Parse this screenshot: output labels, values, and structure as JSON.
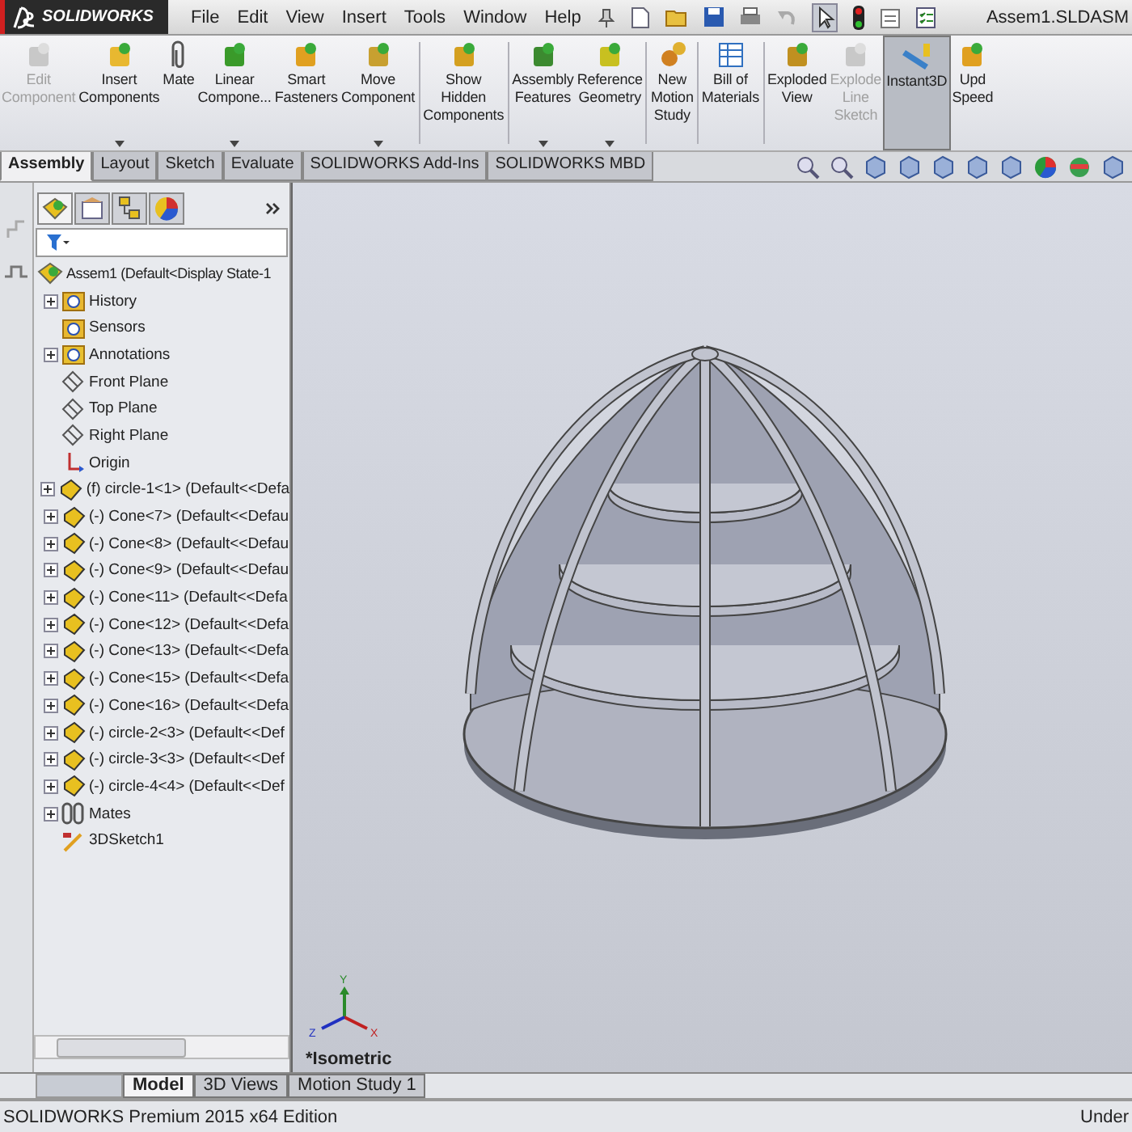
{
  "app_bar": {
    "logo": "SOLIDWORKS",
    "menu": [
      "File",
      "Edit",
      "View",
      "Insert",
      "Tools",
      "Window",
      "Help"
    ],
    "document_title": "Assem1.SLDASM"
  },
  "ribbon": [
    {
      "items": [
        {
          "label": "Edit\nComponent",
          "disabled": true,
          "dropdown": false,
          "selected": false
        },
        {
          "label": "Insert\nComponents",
          "disabled": false,
          "dropdown": true,
          "selected": false
        },
        {
          "label": "Mate",
          "disabled": false,
          "dropdown": false,
          "selected": false
        },
        {
          "label": "Linear\nCompone...",
          "disabled": false,
          "dropdown": true,
          "selected": false
        },
        {
          "label": "Smart\nFasteners",
          "disabled": false,
          "dropdown": false,
          "selected": false
        },
        {
          "label": "Move\nComponent",
          "disabled": false,
          "dropdown": true,
          "selected": false
        }
      ]
    },
    {
      "items": [
        {
          "label": "Show\nHidden\nComponents",
          "disabled": false,
          "dropdown": false,
          "selected": false
        }
      ]
    },
    {
      "items": [
        {
          "label": "Assembly\nFeatures",
          "disabled": false,
          "dropdown": true,
          "selected": false
        },
        {
          "label": "Reference\nGeometry",
          "disabled": false,
          "dropdown": true,
          "selected": false
        }
      ]
    },
    {
      "items": [
        {
          "label": "New\nMotion\nStudy",
          "disabled": false,
          "dropdown": false,
          "selected": false
        }
      ]
    },
    {
      "items": [
        {
          "label": "Bill of\nMaterials",
          "disabled": false,
          "dropdown": false,
          "selected": false
        }
      ]
    },
    {
      "items": [
        {
          "label": "Exploded\nView",
          "disabled": false,
          "dropdown": false,
          "selected": false
        },
        {
          "label": "Explode\nLine\nSketch",
          "disabled": true,
          "dropdown": false,
          "selected": false
        },
        {
          "label": "Instant3D",
          "disabled": false,
          "dropdown": false,
          "selected": true
        },
        {
          "label": "Upd\nSpeed",
          "disabled": false,
          "dropdown": false,
          "selected": false
        }
      ]
    }
  ],
  "command_tabs": [
    {
      "label": "Assembly",
      "selected": true
    },
    {
      "label": "Layout",
      "selected": false
    },
    {
      "label": "Sketch",
      "selected": false
    },
    {
      "label": "Evaluate",
      "selected": false
    },
    {
      "label": "SOLIDWORKS Add-Ins",
      "selected": false
    },
    {
      "label": "SOLIDWORKS MBD",
      "selected": false
    }
  ],
  "feature_tree": {
    "root": "Assem1  (Default<Display State-1",
    "items": [
      {
        "kind": "history",
        "label": "History",
        "expandable": true
      },
      {
        "kind": "sensors",
        "label": "Sensors",
        "expandable": false
      },
      {
        "kind": "annotations",
        "label": "Annotations",
        "expandable": true
      },
      {
        "kind": "plane",
        "label": "Front Plane",
        "expandable": false
      },
      {
        "kind": "plane",
        "label": "Top Plane",
        "expandable": false
      },
      {
        "kind": "plane",
        "label": "Right Plane",
        "expandable": false
      },
      {
        "kind": "origin",
        "label": "Origin",
        "expandable": false
      },
      {
        "kind": "part",
        "label": "(f) circle-1<1> (Default<<Defa",
        "expandable": true
      },
      {
        "kind": "part",
        "label": "(-) Cone<7> (Default<<Defau",
        "expandable": true
      },
      {
        "kind": "part",
        "label": "(-) Cone<8> (Default<<Defau",
        "expandable": true
      },
      {
        "kind": "part",
        "label": "(-) Cone<9> (Default<<Defau",
        "expandable": true
      },
      {
        "kind": "part",
        "label": "(-) Cone<11> (Default<<Defa",
        "expandable": true
      },
      {
        "kind": "part",
        "label": "(-) Cone<12> (Default<<Defa",
        "expandable": true
      },
      {
        "kind": "part",
        "label": "(-) Cone<13> (Default<<Defa",
        "expandable": true
      },
      {
        "kind": "part",
        "label": "(-) Cone<15> (Default<<Defa",
        "expandable": true
      },
      {
        "kind": "part",
        "label": "(-) Cone<16> (Default<<Defa",
        "expandable": true
      },
      {
        "kind": "part",
        "label": "(-) circle-2<3> (Default<<Def",
        "expandable": true
      },
      {
        "kind": "part",
        "label": "(-) circle-3<3> (Default<<Def",
        "expandable": true
      },
      {
        "kind": "part",
        "label": "(-) circle-4<4> (Default<<Def",
        "expandable": true
      },
      {
        "kind": "mates",
        "label": "Mates",
        "expandable": true
      },
      {
        "kind": "sketch",
        "label": "3DSketch1",
        "expandable": false
      }
    ]
  },
  "viewport": {
    "view_name": "*Isometric",
    "triad": {
      "x": "X",
      "y": "Y",
      "z": "Z"
    }
  },
  "bottom_tabs": [
    {
      "label": "Model",
      "selected": true
    },
    {
      "label": "3D Views",
      "selected": false
    },
    {
      "label": "Motion Study 1",
      "selected": false
    }
  ],
  "status_bar": {
    "edition": "SOLIDWORKS Premium 2015 x64 Edition",
    "state": "Under"
  }
}
